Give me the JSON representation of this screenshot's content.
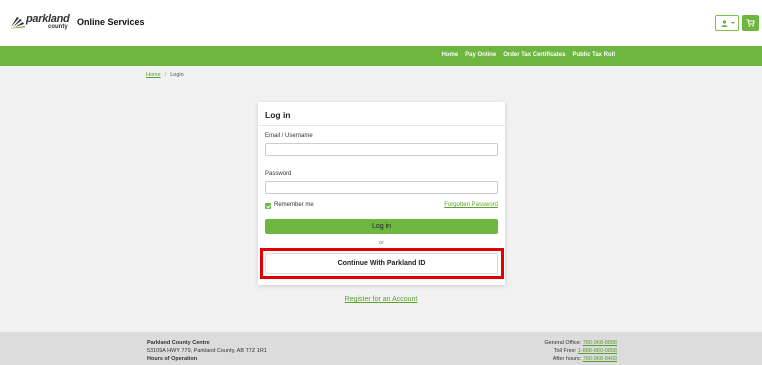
{
  "header": {
    "logo_word": "parkland",
    "logo_sub": "county",
    "site_title": "Online Services",
    "user_icon": "user-icon",
    "cart_icon": "cart-icon",
    "colors": {
      "brand_green": "#6db63f",
      "accent_red": "#e00000"
    }
  },
  "nav": {
    "items": [
      "Home",
      "Pay Online",
      "Order Tax Certificates",
      "Public Tax Roll"
    ]
  },
  "breadcrumb": {
    "home": "Home",
    "separator": "/",
    "current": "Login"
  },
  "login_card": {
    "title": "Log in",
    "email_label": "Email / Username",
    "email_value": "",
    "password_label": "Password",
    "password_value": "",
    "remember_label": "Remember me",
    "remember_checked": true,
    "forgot_label": "Forgotten Password",
    "login_button": "Log in",
    "or_text": "or",
    "parkland_id_button": "Continue With Parkland ID"
  },
  "register_link": "Register for an Account",
  "footer": {
    "org_name": "Parkland County Centre",
    "address": "53109A HWY 779, Parkland County, AB T7Z 1R1",
    "hours_title": "Hours of Operation",
    "general_label": "General Office:",
    "general_phone": "780-968-8888",
    "tollfree_label": "Toll Free:",
    "tollfree_phone": "1-888-880-0858",
    "afterhours_label": "After hours:",
    "afterhours_phone": "780-968-8400"
  }
}
